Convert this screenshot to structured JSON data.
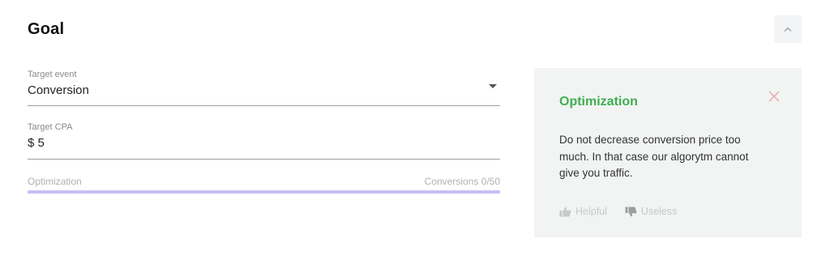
{
  "goal": {
    "title": "Goal"
  },
  "form": {
    "target_event": {
      "label": "Target event",
      "value": "Conversion"
    },
    "target_cpa": {
      "label": "Target CPA",
      "value": "$ 5"
    },
    "optimization": {
      "label": "Optimization",
      "count_text": "Conversions 0/50",
      "progress": 0
    }
  },
  "tip": {
    "title": "Optimization",
    "text": "Do not decrease conversion price too much. In that case our algorytm cannot give you traffic.",
    "helpful_label": "Helpful",
    "useless_label": "Useless"
  },
  "colors": {
    "tip_title": "#3fae4f",
    "tip_background": "#f1f4f3",
    "progress_track": "#c7bff2"
  },
  "icons": {
    "collapse": "chevron-up-icon",
    "dropdown": "caret-down-icon",
    "close": "close-icon",
    "helpful": "thumbs-up-icon",
    "useless": "thumbs-down-icon"
  }
}
